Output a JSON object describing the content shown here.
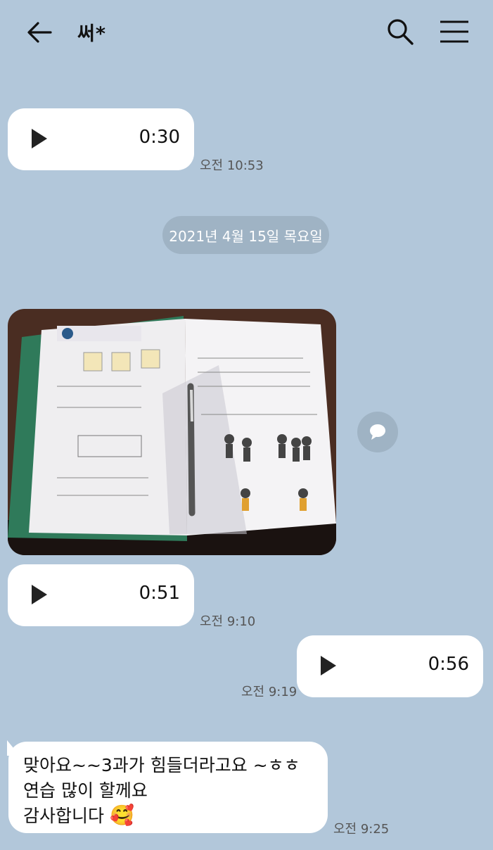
{
  "header": {
    "title": "써*",
    "back_icon": "arrow-left-icon",
    "search_icon": "search-icon",
    "menu_icon": "hamburger-menu-icon"
  },
  "messages": [
    {
      "type": "voice",
      "side": "left",
      "duration": "0:30",
      "time": "오전 10:53"
    },
    {
      "type": "date",
      "label": "2021년 4월 15일 목요일"
    },
    {
      "type": "photo",
      "side": "left"
    },
    {
      "type": "voice",
      "side": "left",
      "duration": "0:51",
      "time": "오전 9:10"
    },
    {
      "type": "voice",
      "side": "right",
      "duration": "0:56",
      "time": "오전 9:19"
    },
    {
      "type": "text",
      "side": "left",
      "lines": [
        "맞아요~~3과가 힘들더라고요 ~ㅎㅎ",
        "연습 많이 할께요",
        "감사합니다"
      ],
      "emoji": "🥰",
      "time": "오전 9:25"
    }
  ],
  "colors": {
    "background": "#b2c7da",
    "bubble": "#ffffff",
    "date_pill": "#9fb3c4"
  }
}
